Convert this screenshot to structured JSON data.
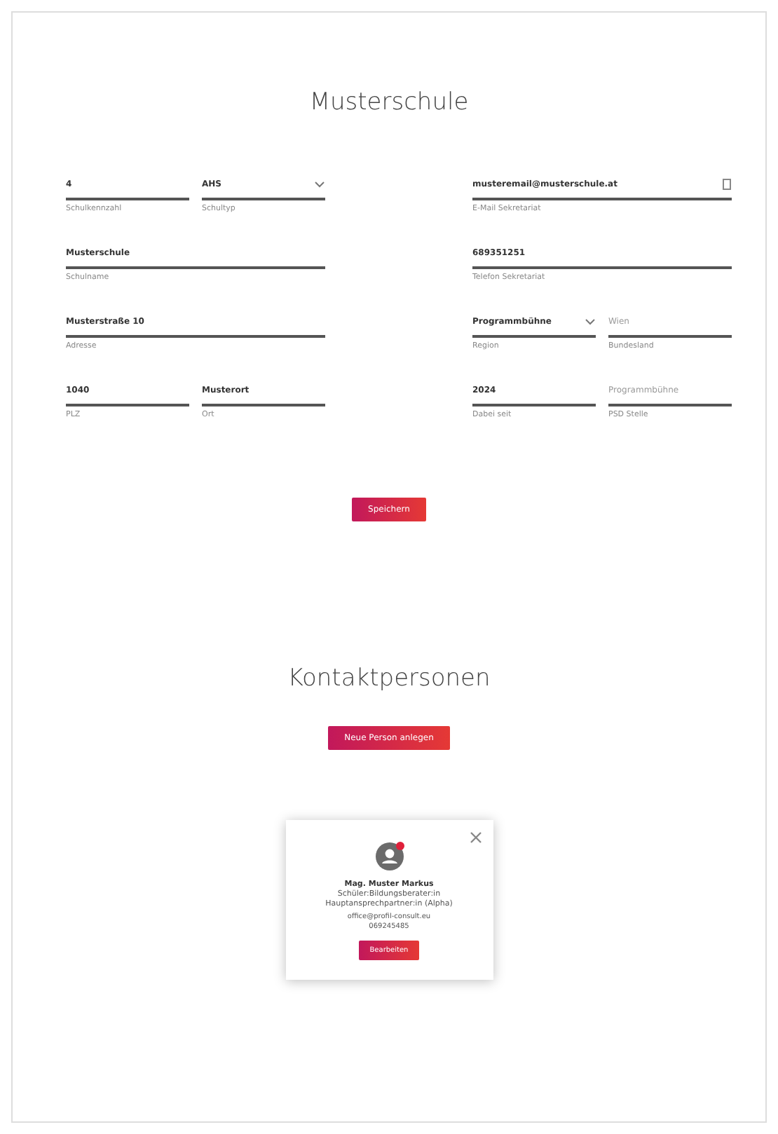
{
  "school": {
    "title": "Musterschule",
    "rows": [
      {
        "left": [
          {
            "kind": "text",
            "value": "4",
            "label": "Schulkennzahl"
          },
          {
            "kind": "select",
            "value": "AHS",
            "label": "Schultyp"
          }
        ],
        "right": [
          {
            "kind": "copy",
            "value": "musteremail@musterschule.at",
            "label": "E-Mail Sekretariat"
          }
        ]
      },
      {
        "left": [
          {
            "kind": "text",
            "value": "Musterschule",
            "label": "Schulname"
          }
        ],
        "right": [
          {
            "kind": "text",
            "value": "689351251",
            "label": "Telefon Sekretariat"
          }
        ]
      },
      {
        "left": [
          {
            "kind": "text",
            "value": "Musterstraße 10",
            "label": "Adresse"
          }
        ],
        "right": [
          {
            "kind": "select",
            "value": "Programmbühne",
            "label": "Region"
          },
          {
            "kind": "text",
            "placeholder": "Wien",
            "label": "Bundesland"
          }
        ]
      },
      {
        "left": [
          {
            "kind": "text",
            "value": "1040",
            "label": "PLZ"
          },
          {
            "kind": "text",
            "value": "Musterort",
            "label": "Ort"
          }
        ],
        "right": [
          {
            "kind": "text",
            "value": "2024",
            "label": "Dabei seit"
          },
          {
            "kind": "text",
            "placeholder": "Programmbühne",
            "label": "PSD Stelle"
          }
        ]
      }
    ],
    "save_button": "Speichern"
  },
  "contacts": {
    "title": "Kontaktpersonen",
    "add_button": "Neue Person anlegen",
    "cards": [
      {
        "name": "Mag. Muster Markus",
        "role": "Schüler:Bildungsberater:in Hauptansprechpartner:in (Alpha)",
        "email": "office@profil-consult.eu",
        "phone": "069245485",
        "button": "Bearbeiten",
        "badge": true
      }
    ]
  }
}
